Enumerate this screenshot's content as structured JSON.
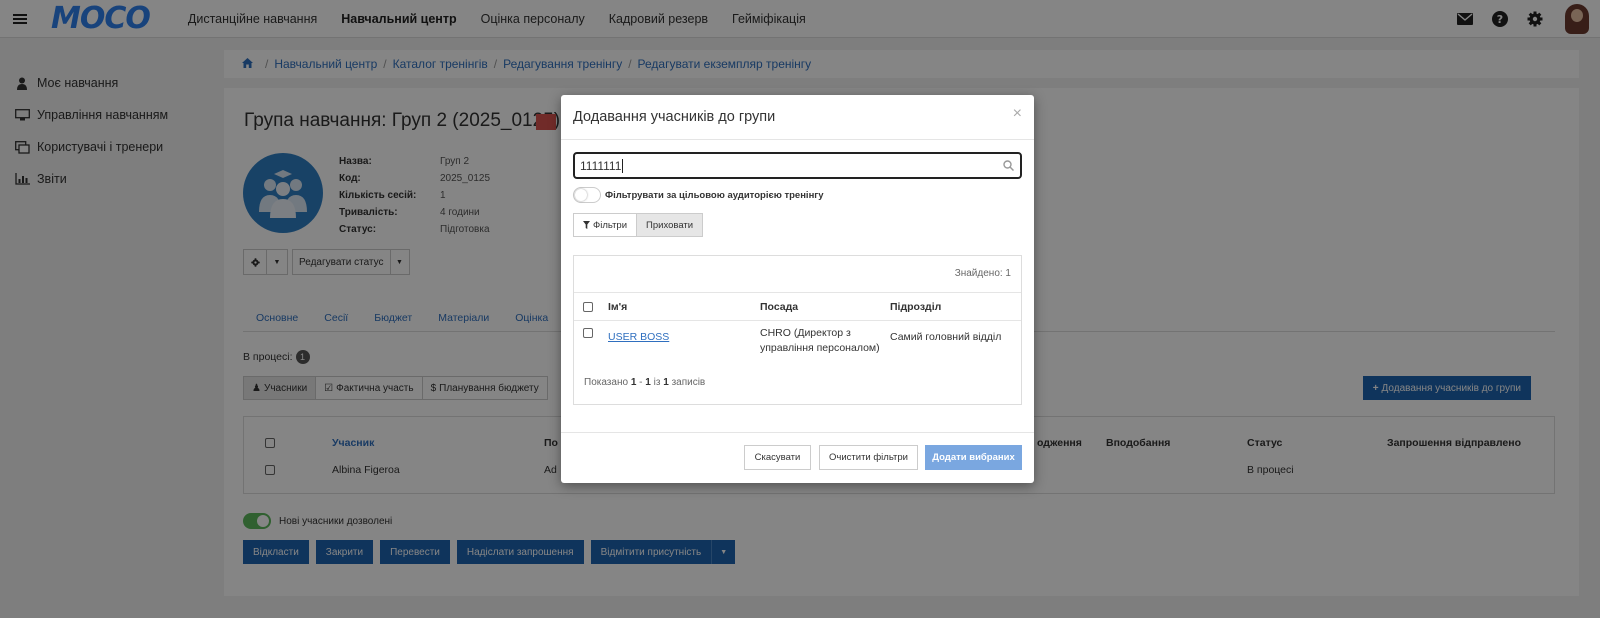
{
  "app": {
    "logo": "MOCO"
  },
  "topnav": [
    "Дистанційне навчання",
    "Навчальний центр",
    "Оцінка персоналу",
    "Кадровий резерв",
    "Гейміфікація"
  ],
  "top_icons": [
    "envelope-icon",
    "help-icon",
    "gear-icon",
    "user-avatar"
  ],
  "sidebar": {
    "items": [
      {
        "label": "Моє навчання",
        "icon": "person-icon"
      },
      {
        "label": "Управління навчанням",
        "icon": "monitor-icon"
      },
      {
        "label": "Користувачі і тренери",
        "icon": "users-icon"
      },
      {
        "label": "Звіти",
        "icon": "chart-icon"
      }
    ]
  },
  "breadcrumb": [
    "Навчальний центр",
    "Каталог тренінгів",
    "Редагування тренінгу",
    "Редагувати екземпляр тренінгу"
  ],
  "page": {
    "title": "Група навчання: Груп 2 (2025_0125)",
    "info": [
      {
        "k": "Назва:",
        "v": "Груп 2"
      },
      {
        "k": "Код:",
        "v": "2025_0125"
      },
      {
        "k": "Кількість сесій:",
        "v": "1"
      },
      {
        "k": "Тривалість:",
        "v": "4 години"
      },
      {
        "k": "Статус:",
        "v": "Підготовка"
      }
    ],
    "edit_status_label": "Редагувати статус",
    "tabs": [
      "Основне",
      "Сесії",
      "Бюджет",
      "Матеріали",
      "Оцінка"
    ],
    "status_label": "В процесі:",
    "status_count": "1",
    "sub_tabs": [
      "Учасники",
      "Фактична участь",
      "Планування бюджету"
    ],
    "add_participants_label": "Додавання учасників до групи",
    "table": {
      "headers": [
        "Учасник",
        "По",
        "одження",
        "Вподобання",
        "Статус",
        "Запрошення відправлено"
      ],
      "rows": [
        {
          "name": "Albina Figeroa",
          "col2": "Ad",
          "status": "В процесі"
        }
      ]
    },
    "new_participants_allowed": "Нові учасники дозволені",
    "actions": [
      "Відкласти",
      "Закрити",
      "Перевести",
      "Надіслати запрошення",
      "Відмітити присутність"
    ]
  },
  "modal": {
    "title": "Додавання учасників до групи",
    "close": "×",
    "search_value": "1111111",
    "filter_by_audience": "Фільтрувати за цільовою аудиторією тренінгу",
    "filters_label": "Фільтри",
    "hide_label": "Приховати",
    "found": "Знайдено: 1",
    "headers": [
      "Ім'я",
      "Посада",
      "Підрозділ"
    ],
    "rows": [
      {
        "name": "USER BOSS",
        "position": "CHRO (Директор з управління персоналом)",
        "department": "Самий головний відділ"
      }
    ],
    "shown_prefix": "Показано",
    "shown_from": "1",
    "shown_dash": "-",
    "shown_to": "1",
    "shown_of": "із",
    "shown_total": "1",
    "shown_suffix": "записів",
    "cancel": "Скасувати",
    "clear_filters": "Очистити фільтри",
    "add_selected": "Додати вибраних"
  },
  "colors": {
    "brand": "#2f80ed",
    "primary_button": "#1e64b0",
    "disabled_primary": "#7aa7e0",
    "toggle_on": "#5cb85c"
  }
}
